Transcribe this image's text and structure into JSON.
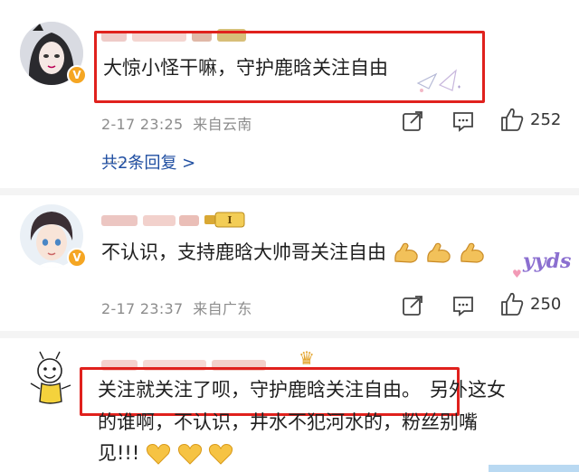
{
  "comments": [
    {
      "text": "大惊小怪干嘛，守护鹿晗关注自由",
      "time": "2-17 23:25",
      "location": "来自云南",
      "likes": "252",
      "replies_label": "共2条回复 >"
    },
    {
      "text": "不认识，支持鹿晗大帅哥关注自由",
      "time": "2-17 23:37",
      "location": "来自广东",
      "likes": "250",
      "sticker": "yyds"
    },
    {
      "text_boxed": "关注就关注了呗，守护鹿晗关注自由。",
      "text_after": "另外这女",
      "line2": "的谁啊，不认识，井水不犯河水的，粉丝别嘴",
      "line3": "见!!!"
    }
  ],
  "icons": {
    "share": "share-icon",
    "comment": "comment-icon",
    "like": "thumbs-up-icon",
    "verified": "verified-v-icon",
    "muscle": "flexed-biceps-emoji",
    "heart": "yellow-heart-emoji"
  },
  "colors": {
    "highlight_box": "#e0211d",
    "link": "#1f4ea1",
    "meta": "#8c8c8c",
    "badge": "#f5a623"
  }
}
